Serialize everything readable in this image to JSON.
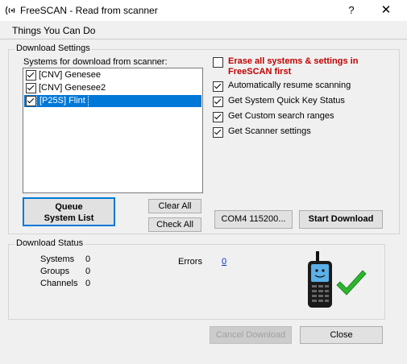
{
  "window": {
    "title": "FreeSCAN - Read from scanner",
    "help_label": "?",
    "close_label": "✕",
    "app_icon": "radio-waves-icon"
  },
  "menu": {
    "things_label": "Things You Can Do"
  },
  "download_settings": {
    "group_label": "Download Settings",
    "list_label": "Systems for download from scanner:",
    "systems": [
      {
        "label": "[CNV] Genesee",
        "checked": true,
        "selected": false
      },
      {
        "label": "[CNV] Genesee2",
        "checked": true,
        "selected": false
      },
      {
        "label": "[P25S] Flint",
        "checked": true,
        "selected": true
      }
    ],
    "options": {
      "erase": {
        "label": "Erase all systems & settings in FreeSCAN first",
        "checked": false
      },
      "resume": {
        "label": "Automatically resume scanning",
        "checked": true
      },
      "quick_key": {
        "label": "Get System Quick Key Status",
        "checked": true
      },
      "custom_search": {
        "label": "Get Custom search ranges",
        "checked": true
      },
      "scanner_settings": {
        "label": "Get Scanner settings",
        "checked": true
      }
    },
    "buttons": {
      "queue": "Queue System List",
      "clear_all": "Clear All",
      "check_all": "Check All",
      "com_port": "COM4 115200...",
      "start_download": "Start Download"
    }
  },
  "download_status": {
    "group_label": "Download Status",
    "systems_label": "Systems",
    "systems_value": "0",
    "groups_label": "Groups",
    "groups_value": "0",
    "channels_label": "Channels",
    "channels_value": "0",
    "errors_label": "Errors",
    "errors_value": "0",
    "status_image": "scanner-radio-checkmark-icon"
  },
  "footer": {
    "cancel_label": "Cancel Download",
    "close_label": "Close"
  },
  "colors": {
    "warning": "#c00000",
    "selection": "#0078d7",
    "link": "#0033cc",
    "check_green": "#2db52d"
  }
}
